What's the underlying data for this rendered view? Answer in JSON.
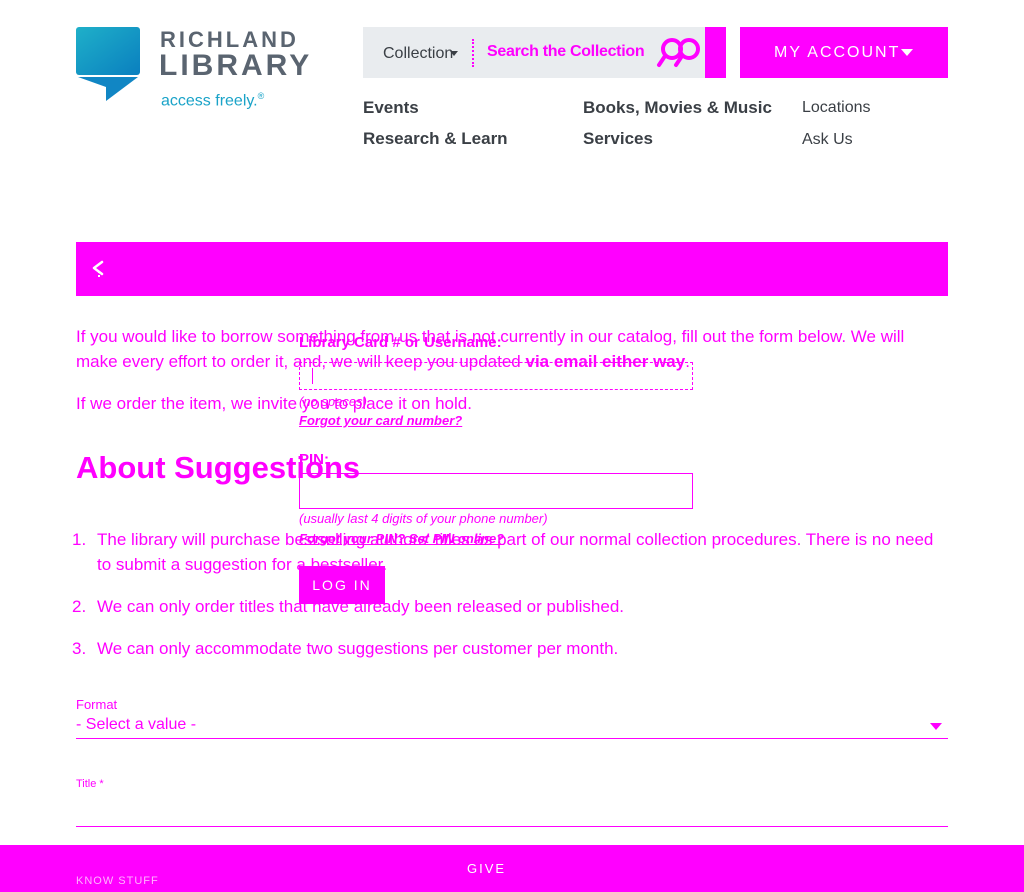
{
  "header": {
    "logo_line1": "RICHLAND",
    "logo_line2": "LIBRARY",
    "logo_tagline": "access freely.",
    "logo_mark": "®",
    "search": {
      "collection_label": "Collection",
      "placeholder": "Search the Collection",
      "icon": "search-icon"
    },
    "account_label": "MY ACCOUNT",
    "nav": {
      "events": "Events",
      "research": "Research & Learn",
      "books": "Books, Movies & Music",
      "services": "Services",
      "locations": "Locations",
      "ask": "Ask Us"
    }
  },
  "content": {
    "intro_1_a": "If you would like to borrow something from us that is not currently in our catalog, fill out the form below. We will make every effort to order it, and, we will keep you updated ",
    "intro_1_b": "via email either way",
    "intro_1_c": ".",
    "intro_2": "If we order the item, we invite you to place it on hold.",
    "heading": "About Suggestions",
    "list": [
      {
        "num": "1.",
        "text": "The library will purchase bestselling authors' titles as part of our normal collection procedures. There is no need to submit a suggestion for a bestseller."
      },
      {
        "num": "2.",
        "text": "We can only order titles that have already been released or published."
      },
      {
        "num": "3.",
        "text": "We can only accommodate two suggestions per customer per month."
      }
    ]
  },
  "form": {
    "format_label": "Format",
    "format_value": "- Select a value -",
    "title_label": "Title *"
  },
  "login": {
    "card_label": "Library Card # or Username:",
    "card_hint": "(no spaces)",
    "forgot_card": "Forgot your card number?",
    "pin_label": "PIN:",
    "pin_hint": "(usually last 4 digits of your phone number)",
    "forgot_pin": "Forgot your PIN? Set PIN online?",
    "button": "LOG IN"
  },
  "footer": {
    "give": "GIVE",
    "faint": "KNOW STUFF"
  },
  "colors": {
    "accent": "#ff00ff",
    "logo_teal": "#1aa3c8",
    "logo_gray": "#5a6470"
  }
}
